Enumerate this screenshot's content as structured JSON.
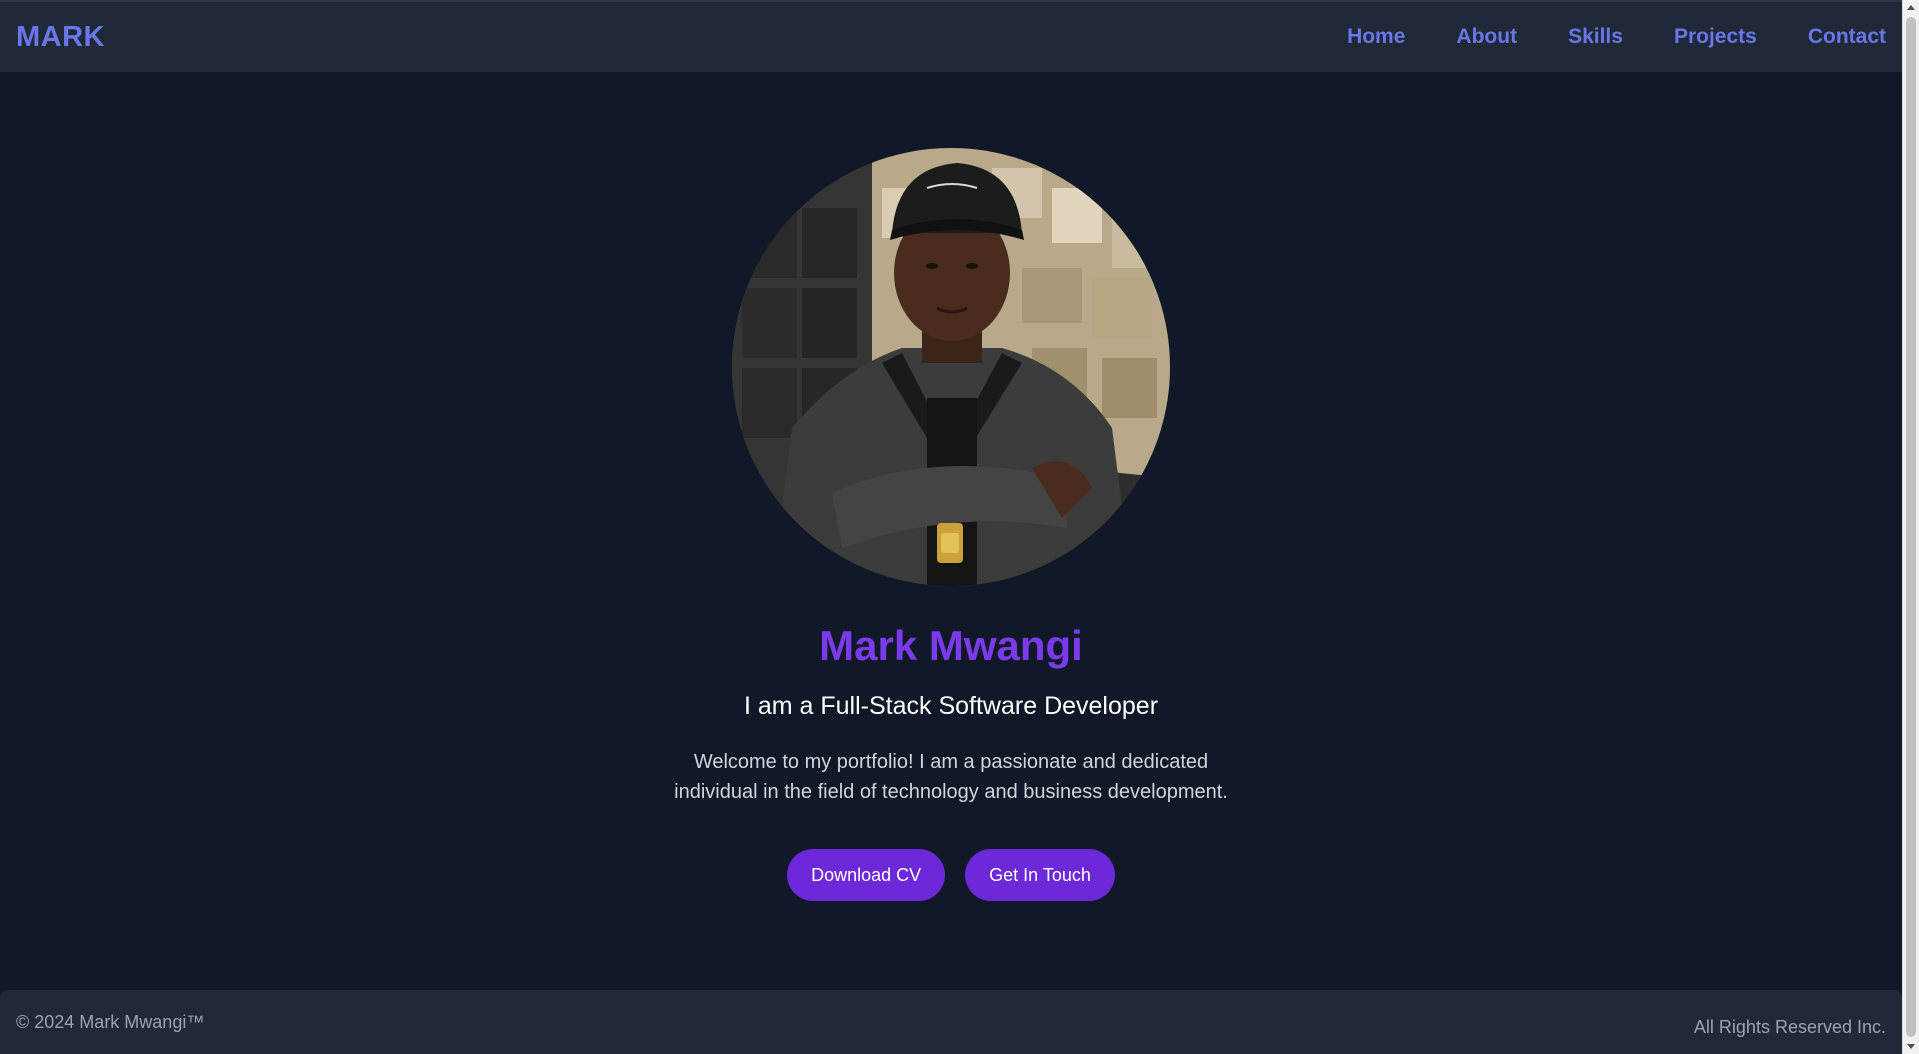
{
  "nav": {
    "brand": "MARK",
    "links": [
      {
        "label": "Home"
      },
      {
        "label": "About"
      },
      {
        "label": "Skills"
      },
      {
        "label": "Projects"
      },
      {
        "label": "Contact"
      }
    ]
  },
  "hero": {
    "avatar_alt": "portrait photo",
    "name": "Mark Mwangi",
    "subtitle": "I am a Full-Stack Software Developer",
    "intro": "Welcome to my portfolio! I am a passionate and dedicated individual in the field of technology and business development.",
    "buttons": {
      "download_cv": "Download CV",
      "get_in_touch": "Get In Touch"
    }
  },
  "footer": {
    "copyright": "© 2024 Mark Mwangi™",
    "rights": "All Rights Reserved Inc."
  },
  "colors": {
    "background": "#111827",
    "surface": "#1f2937",
    "accent_nav": "#6b76ea",
    "accent_name": "#7c3aed",
    "button": "#6d28d9"
  }
}
